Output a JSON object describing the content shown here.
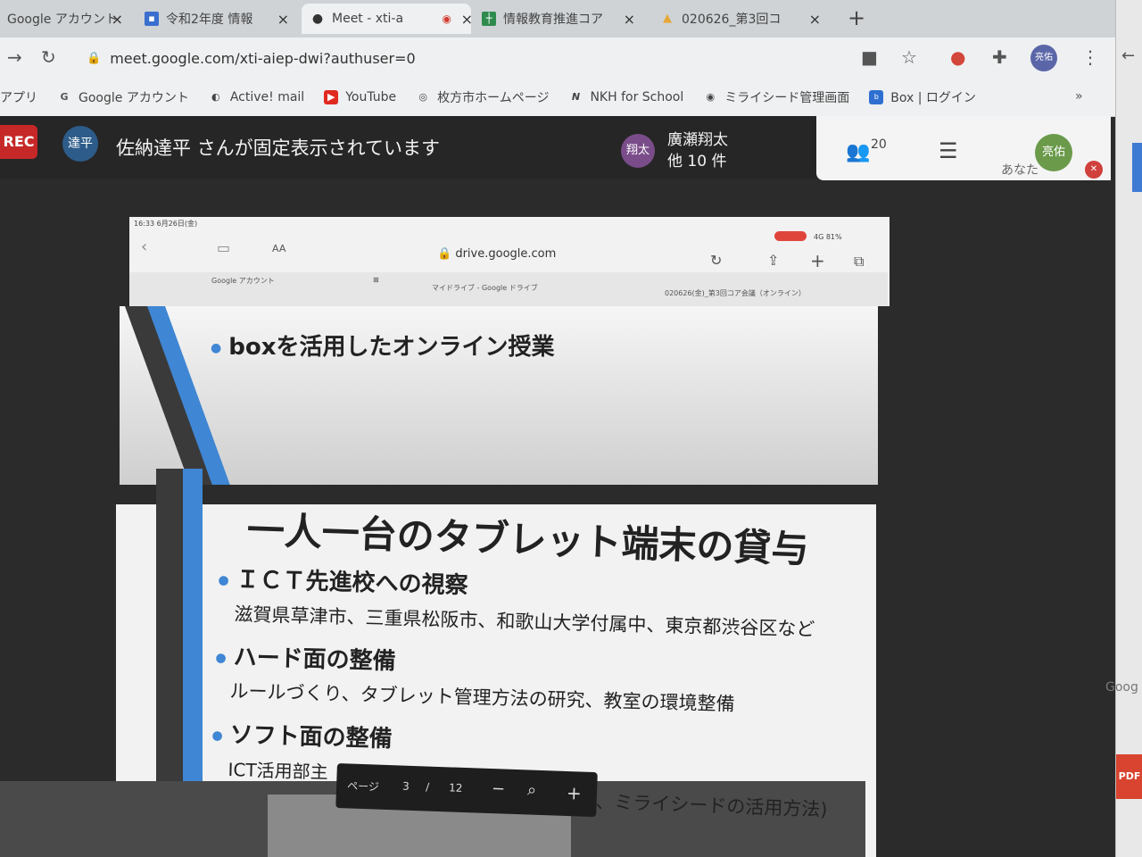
{
  "tabs": [
    {
      "title": "Google アカウント",
      "favicon": "google-g-icon",
      "close": "×"
    },
    {
      "title": "令和2年度 情報",
      "favicon": "document-icon",
      "close": "×"
    },
    {
      "title": "Meet - xti-a",
      "favicon": "meet-icon",
      "close": "×",
      "recording": true
    },
    {
      "title": "情報教育推進コア",
      "favicon": "sheets-icon",
      "close": "×"
    },
    {
      "title": "020626_第3回コ",
      "favicon": "drive-icon",
      "close": "×"
    }
  ],
  "new_tab": "+",
  "address": {
    "url": "meet.google.com/xti-aiep-dwi?authuser=0"
  },
  "profile_initials": "亮佑",
  "bookmarks": [
    {
      "label": "アプリ",
      "icon": "apps-icon"
    },
    {
      "label": "Google アカウント",
      "icon": "google-g-icon"
    },
    {
      "label": "Active! mail",
      "icon": "mail-icon"
    },
    {
      "label": "YouTube",
      "icon": "youtube-icon"
    },
    {
      "label": "枚方市ホームページ",
      "icon": "city-icon"
    },
    {
      "label": "NKH for School",
      "icon": "nkh-icon"
    },
    {
      "label": "ミライシード管理画面",
      "icon": "mirai-icon"
    },
    {
      "label": "Box | ログイン",
      "icon": "box-icon"
    }
  ],
  "bookmarks_more": "»",
  "meet": {
    "rec": "REC",
    "pinned_avatar": "達平",
    "pinned_text": "佐納達平 さんが固定表示されています",
    "presenter_avatar": "翔太",
    "presenter_name": "廣瀬翔太",
    "presenter_others": "他 10 件",
    "participant_count": "20",
    "self_avatar": "亮佑",
    "self_label": "あなた"
  },
  "ipad": {
    "status_time": "16:33  6月26日(金)",
    "status_right": "4G 81%",
    "url": "drive.google.com",
    "tabs": [
      "Google アカウント",
      "マイドライブ - Google ドライブ",
      "020626(金)_第3回コア会議（オンライン）"
    ]
  },
  "slide1": {
    "bullet": "boxを活用したオンライン授業"
  },
  "slide2": {
    "title": "一人一台のタブレット端末の貸与",
    "items": [
      {
        "heading": "ＩＣＴ先進校への視察",
        "body": "滋賀県草津市、三重県松阪市、和歌山大学付属中、東京都渋谷区など"
      },
      {
        "heading": "ハード面の整備",
        "body": "ルールづくり、タブレット管理方法の研究、教室の環境整備"
      },
      {
        "heading": "ソフト面の整備",
        "body": "ICT活用部主"
      }
    ]
  },
  "pdf_toolbar": {
    "page_label": "ページ",
    "page": "3",
    "separator": "/",
    "total": "12",
    "minus": "−",
    "plus": "+"
  },
  "bottom_text": "、ミライシードの活用方法)",
  "right_edge": {
    "goog": "Goog",
    "pdf": "PDF"
  }
}
